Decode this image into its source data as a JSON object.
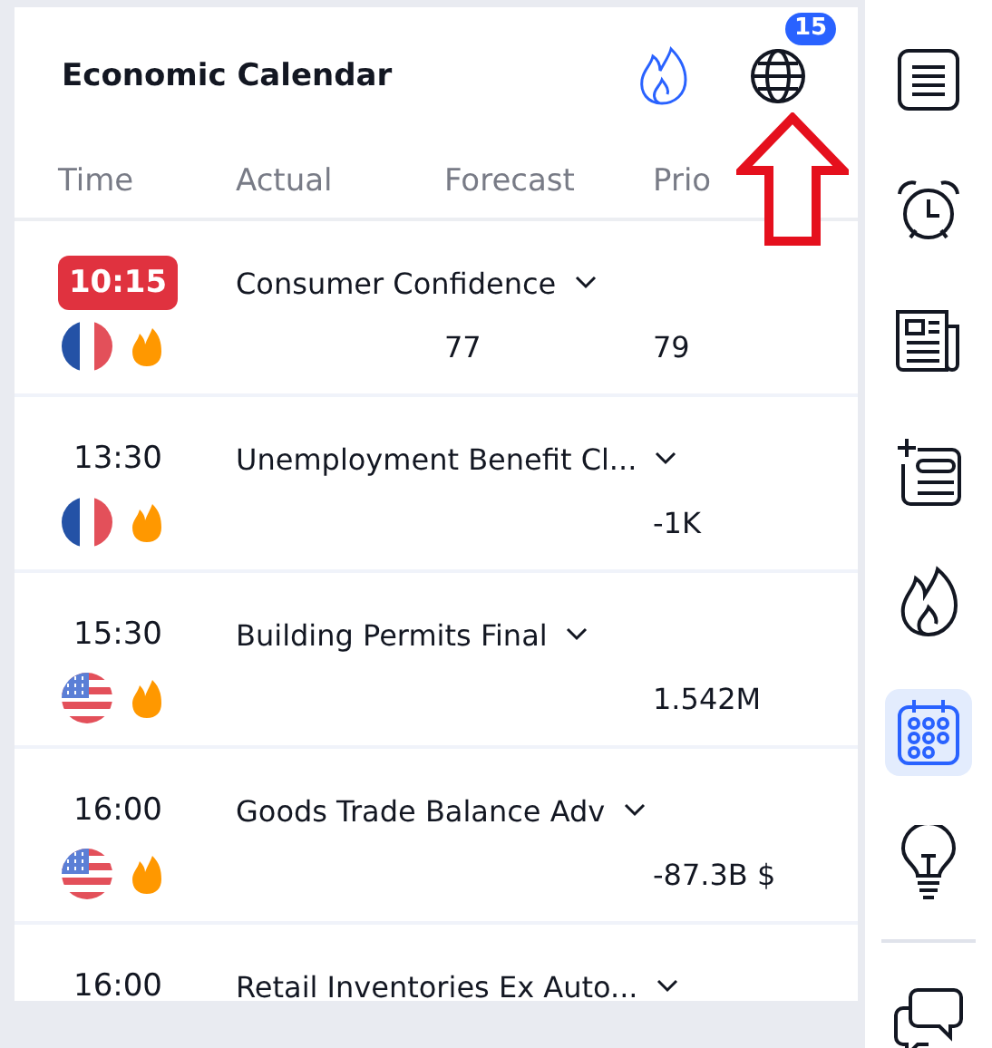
{
  "header": {
    "title": "Economic Calendar",
    "badge": "15"
  },
  "columns": [
    "Time",
    "Actual",
    "Forecast",
    "Prio"
  ],
  "events": [
    {
      "kind": "france",
      "time": "10:15",
      "current": true,
      "name": "Consumer Confidence",
      "forecast": "77",
      "prior": "79"
    },
    {
      "kind": "france",
      "time": "13:30",
      "current": false,
      "name": "Unemployment Benefit Cl...",
      "prior": "-1K"
    },
    {
      "kind": "usa",
      "time": "15:30",
      "current": false,
      "name": "Building Permits Final",
      "prior": "1.542M"
    },
    {
      "kind": "usa",
      "time": "16:00",
      "current": false,
      "name": "Goods Trade Balance Adv",
      "prior": "-87.3B $"
    },
    {
      "kind": "partial",
      "time": "16:00",
      "current": false,
      "name": "Retail Inventories Ex Auto..."
    }
  ],
  "sidebar": {
    "items": [
      {
        "kind": "list",
        "selected": false
      },
      {
        "kind": "alarm",
        "selected": false
      },
      {
        "kind": "news",
        "selected": false
      },
      {
        "kind": "addlist",
        "selected": false
      },
      {
        "kind": "fire",
        "selected": false
      },
      {
        "kind": "calendar",
        "selected": true
      },
      {
        "kind": "bulb",
        "selected": false
      },
      {
        "kind": "chat",
        "selected": false
      }
    ]
  }
}
